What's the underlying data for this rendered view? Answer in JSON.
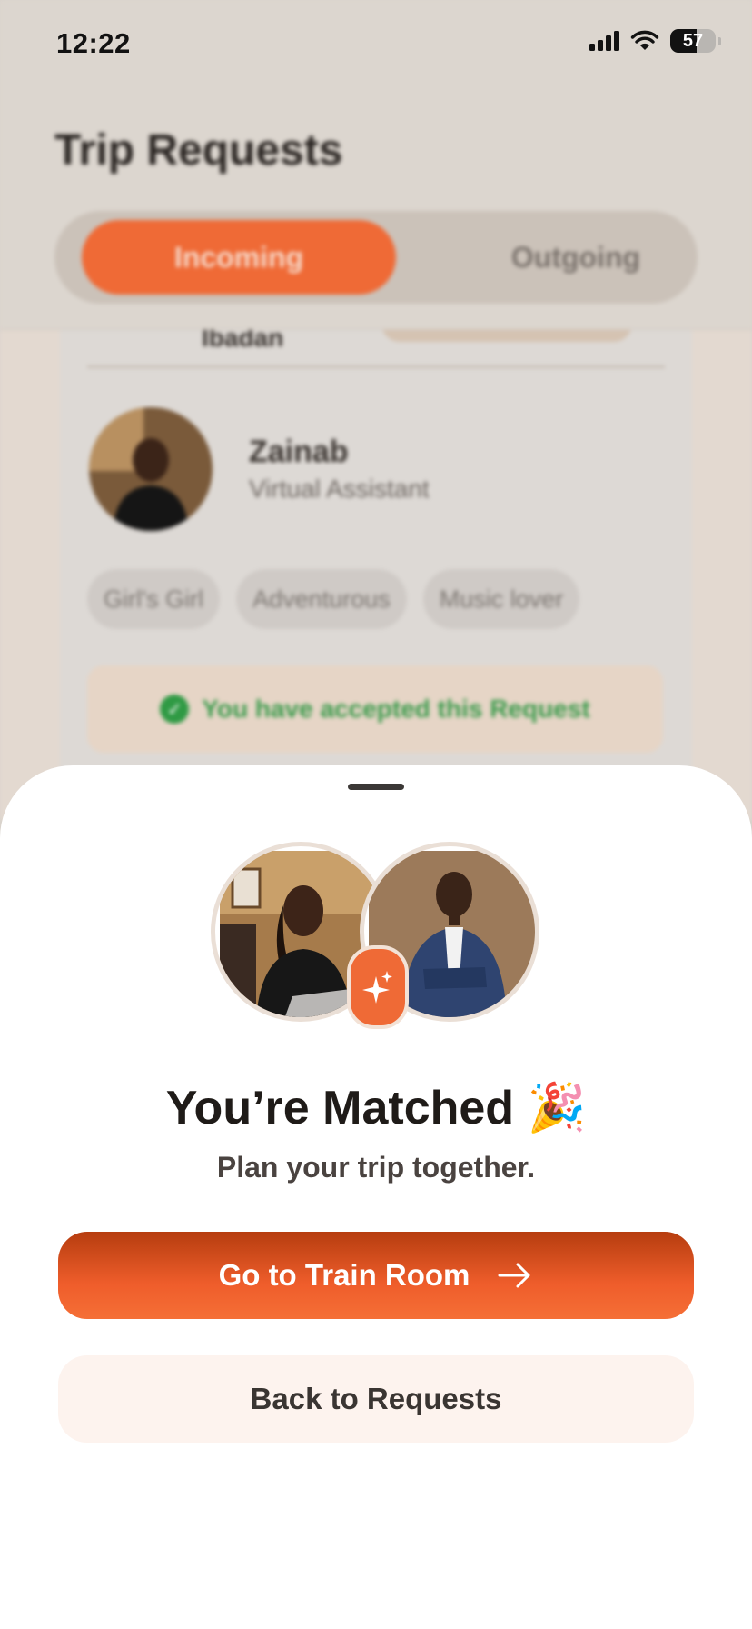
{
  "status_bar": {
    "time": "12:22",
    "battery": "57",
    "battery_level": 0.57
  },
  "page": {
    "title": "Trip Requests"
  },
  "tabs": {
    "incoming": "Incoming",
    "outgoing": "Outgoing"
  },
  "card": {
    "city": "Ibadan",
    "name": "Zainab",
    "role": "Virtual Assistant",
    "tags": [
      "Girl's Girl",
      "Adventurous",
      "Music lover"
    ],
    "status": "You have accepted this Request"
  },
  "match_sheet": {
    "title": "You’re Matched 🎉",
    "subtitle": "Plan your trip together.",
    "primary_button": "Go to Train Room",
    "secondary_button": "Back to Requests"
  },
  "colors": {
    "accent": "#EF6A36",
    "sheet_bg": "#FFFFFF",
    "success": "#2F9A44"
  },
  "icons": [
    "signal-icon",
    "wifi-icon",
    "battery-icon",
    "check-icon",
    "sparkle-icon",
    "arrow-right-icon"
  ]
}
